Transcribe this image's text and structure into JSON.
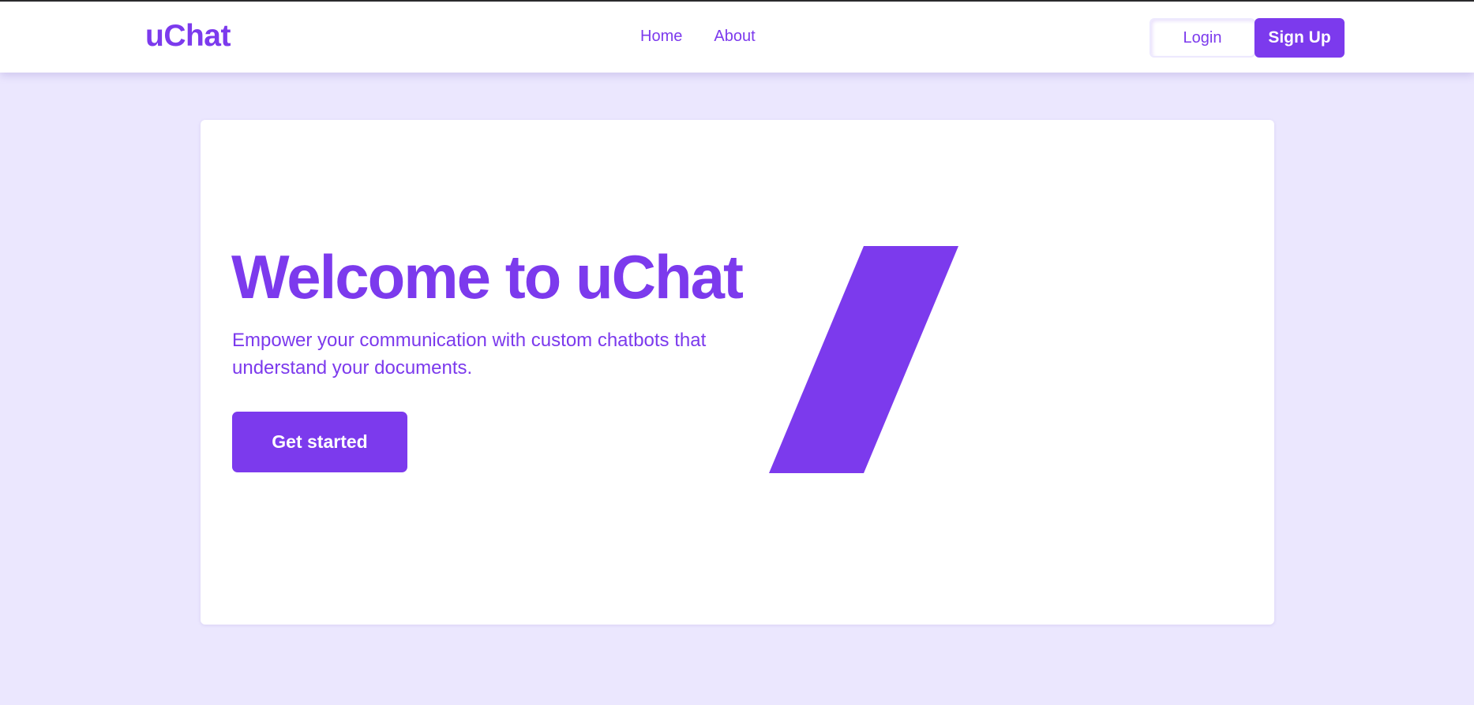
{
  "brand": {
    "name": "uChat",
    "accent_color": "#7c3aed",
    "page_background": "#ebe7fe"
  },
  "nav": {
    "links": [
      {
        "label": "Home"
      },
      {
        "label": "About"
      }
    ],
    "login_label": "Login",
    "signup_label": "Sign Up"
  },
  "hero": {
    "title": "Welcome to uChat",
    "subtitle": "Empower your communication with custom chatbots that understand your documents.",
    "cta_label": "Get started",
    "graphic": "parallelogram-shape"
  }
}
